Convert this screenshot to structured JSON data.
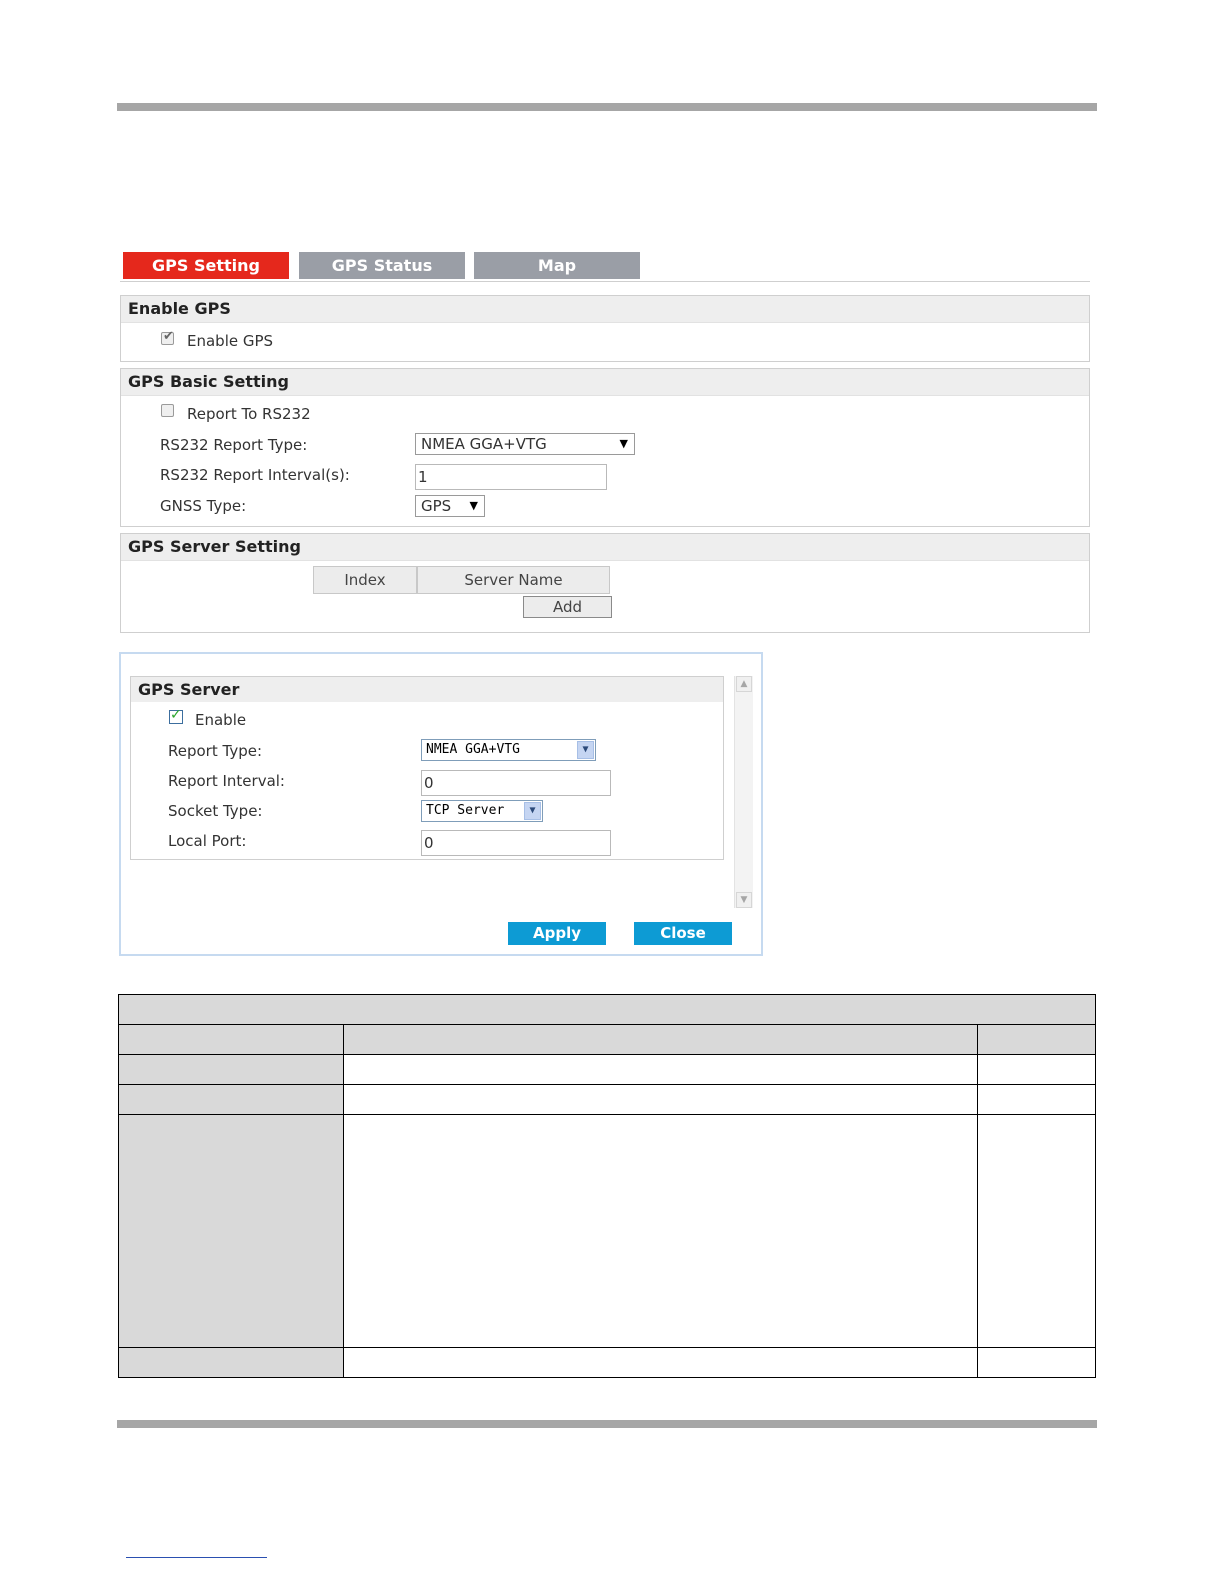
{
  "tabs": [
    {
      "label": "GPS Setting",
      "active": true
    },
    {
      "label": "GPS Status",
      "active": false
    },
    {
      "label": "Map",
      "active": false
    }
  ],
  "enable_gps": {
    "title": "Enable GPS",
    "checkbox_label": "Enable GPS",
    "checked": true
  },
  "basic": {
    "title": "GPS Basic Setting",
    "report_rs232_label": "Report To RS232",
    "report_rs232_checked": false,
    "report_type_label": "RS232 Report Type:",
    "report_type_value": "NMEA GGA+VTG",
    "report_interval_label": "RS232 Report Interval(s):",
    "report_interval_value": "1",
    "gnss_label": "GNSS Type:",
    "gnss_value": "GPS"
  },
  "server_setting": {
    "title": "GPS Server Setting",
    "columns": [
      "Index",
      "Server Name"
    ],
    "add_label": "Add"
  },
  "dialog": {
    "title": "GPS Server",
    "enable_label": "Enable",
    "enable_checked": true,
    "report_type_label": "Report Type:",
    "report_type_value": "NMEA GGA+VTG",
    "report_interval_label": "Report Interval:",
    "report_interval_value": "0",
    "socket_type_label": "Socket Type:",
    "socket_type_value": "TCP Server",
    "local_port_label": "Local Port:",
    "local_port_value": "0",
    "apply_label": "Apply",
    "close_label": "Close"
  },
  "colors": {
    "active_tab": "#e5281c",
    "inactive_tab": "#9a9ea6",
    "dialog_button": "#0d9bd4"
  }
}
